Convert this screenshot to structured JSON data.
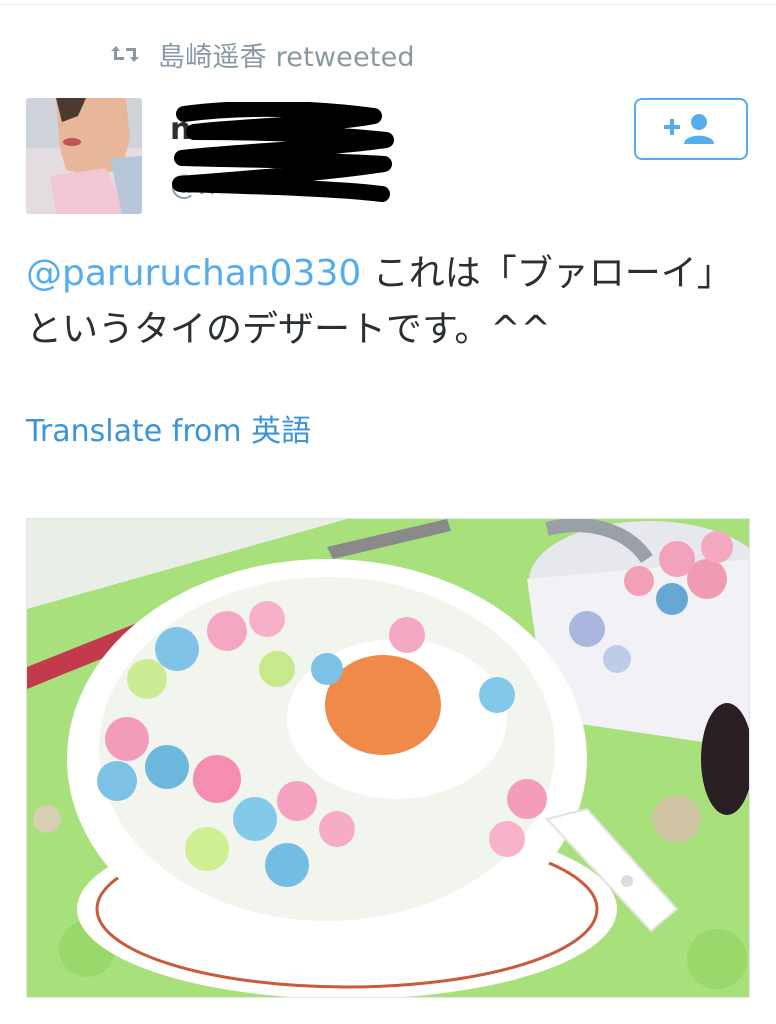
{
  "retweet": {
    "icon": "retweet-icon",
    "label": "島崎遥香 retweeted"
  },
  "author": {
    "avatar_icon": "avatar",
    "display_name": "n",
    "handle": "@n",
    "redacted": true
  },
  "follow": {
    "icon": "follow-user-icon",
    "label": "+"
  },
  "tweet": {
    "mention": "@paruruchan0330",
    "text": " これは「ブァローイ」というタイのデザートです。^^"
  },
  "translate": {
    "label": "Translate from 英語"
  },
  "media": {
    "type": "photo"
  },
  "colors": {
    "link": "#55acee",
    "muted": "#8899a6",
    "text": "#292f33"
  }
}
